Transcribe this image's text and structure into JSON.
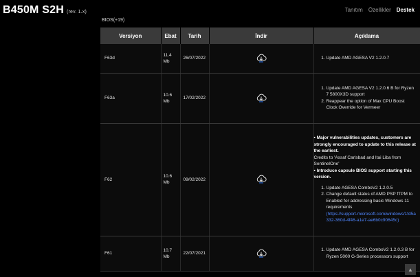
{
  "header": {
    "product_name": "B450M S2H",
    "revision": "(rev. 1.x)",
    "nav": [
      {
        "label": "Tanıtım",
        "active": false
      },
      {
        "label": "Özellikler",
        "active": false
      },
      {
        "label": "Destek",
        "active": true
      }
    ]
  },
  "bios_count": "BIOS(+19)",
  "table": {
    "headers": [
      "Versiyon",
      "Ebat",
      "Tarih",
      "İndir",
      "Açıklama"
    ],
    "rows": [
      {
        "version": "F63d",
        "size": "11.4 Mb",
        "date": "26/07/2022",
        "notes": [
          "Update AMD AGESA V2 1.2.0.7"
        ]
      },
      {
        "version": "F63a",
        "size": "10.6 Mb",
        "date": "17/02/2022",
        "notes": [
          "Update AMD AGESA V2 1.2.0.6 B for Ryzen 7 5800X3D support",
          "Reappear the option of Max CPU Boost Clock Override for Vermeer"
        ]
      },
      {
        "version": "F62",
        "size": "10.6 Mb",
        "date": "09/02/2022",
        "intro_bold_1": "• Major vulnerabilities updates, customers are strongly encouraged to update to this release at the earliest.",
        "intro_plain": "Credits to 'Assaf Carlsbad and Itai Liba from SentinelOne'",
        "intro_bold_2": "• Introduce capsule BIOS support starting this version.",
        "notes": [
          "Update AGESA ComboV2 1.2.0.5",
          "Change default status of AMD PSP fTPM to Enabled for addressing basic Windows 11 requirements"
        ],
        "link": "(https://support.microsoft.com/windows/1fd5a332-360d-4f46-a1e7-ae6b0c90645c)"
      },
      {
        "version": "F61",
        "size": "10.7 Mb",
        "date": "22/07/2021",
        "notes": [
          "Update AMD AGESA ComboV2 1.2.0.3 B for Ryzen 5000 G-Series processors support"
        ]
      }
    ]
  },
  "icons": {
    "download": "cloud-download-icon",
    "scroll": "arrow-up-icon"
  },
  "colors": {
    "background": "#000000",
    "header_row": "#3a3a3a",
    "link": "#4f86ff"
  }
}
